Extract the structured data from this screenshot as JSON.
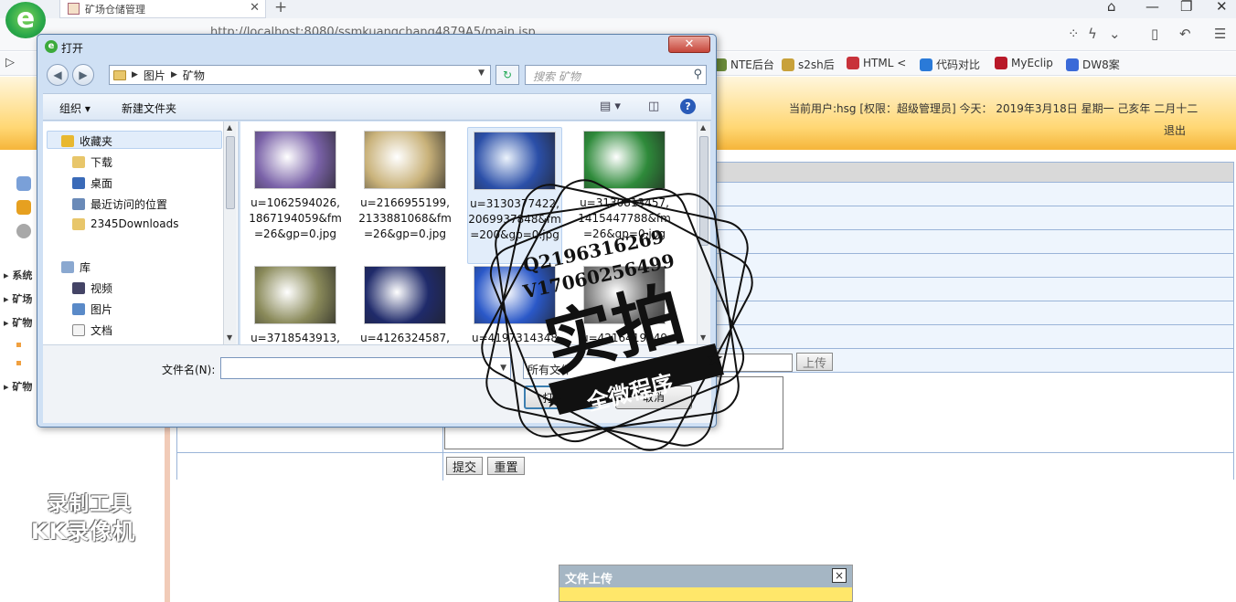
{
  "browser": {
    "tab_title": "矿场仓储管理",
    "url": "http://localhost:8080/ssmkuangchang4879A5/main.jsp",
    "bookmarks": [
      {
        "label": "NTE后台",
        "color": "#6a8a3a"
      },
      {
        "label": "s2sh后",
        "color": "#c8a13a"
      },
      {
        "label": "HTML <",
        "color": "#c8323a"
      },
      {
        "label": "代码对比",
        "color": "#2a7ad8"
      },
      {
        "label": "MyEclip",
        "color": "#b81828"
      },
      {
        "label": "DW8案",
        "color": "#3a6ad8"
      }
    ]
  },
  "header": {
    "user_info": "当前用户:hsg [权限：超级管理员] 今天： 2019年3月18日 星期一 己亥年 二月十二",
    "logout": "退出"
  },
  "sidebar": {
    "items": [
      "系统",
      "矿场",
      "矿物",
      "矿物"
    ]
  },
  "form": {
    "upload_btn": "上传",
    "submit_btn": "提交",
    "reset_btn": "重置"
  },
  "upload_popup": {
    "title": "文件上传",
    "close": "×"
  },
  "watermark": {
    "line1": "录制工具",
    "line2": "KK录像机"
  },
  "dialog": {
    "title": "打开",
    "close": "✕",
    "path": [
      "图片",
      "矿物"
    ],
    "search_placeholder": "搜索 矿物",
    "toolbar": {
      "organize": "组织",
      "new_folder": "新建文件夹"
    },
    "nav": {
      "favorites": "收藏夹",
      "fav_items": [
        "下载",
        "桌面",
        "最近访问的位置",
        "2345Downloads"
      ],
      "library": "库",
      "lib_items": [
        "视频",
        "图片",
        "文档"
      ]
    },
    "files": [
      {
        "caption": "u=1062594026,1867194059&fm=26&gp=0.jpg",
        "color": "#7a62a8"
      },
      {
        "caption": "u=2166955199,2133881068&fm=26&gp=0.jpg",
        "color": "#c9b27a"
      },
      {
        "caption": "u=3130377422,2069937848&fm=200&gp=0.jpg",
        "color": "#2b4fa8"
      },
      {
        "caption": "u=3130813457,1415447788&fm=26&gp=0.jpg",
        "color": "#2e8a3a"
      },
      {
        "caption": "u=3718543913,",
        "color": "#8a8a5a"
      },
      {
        "caption": "u=4126324587,",
        "color": "#1f2a6a"
      },
      {
        "caption": "u=4197314348",
        "color": "#2a58c8"
      },
      {
        "caption": "u=4216419949",
        "color": "#777777"
      }
    ],
    "filename_label": "文件名(N):",
    "filter": "所有文件",
    "open_btn": "打开(O)",
    "cancel_btn": "取消"
  },
  "stamp": {
    "contact1": "Q2196316269",
    "contact2": "V17060256499",
    "main": "实拍",
    "sub": "全微程序"
  }
}
